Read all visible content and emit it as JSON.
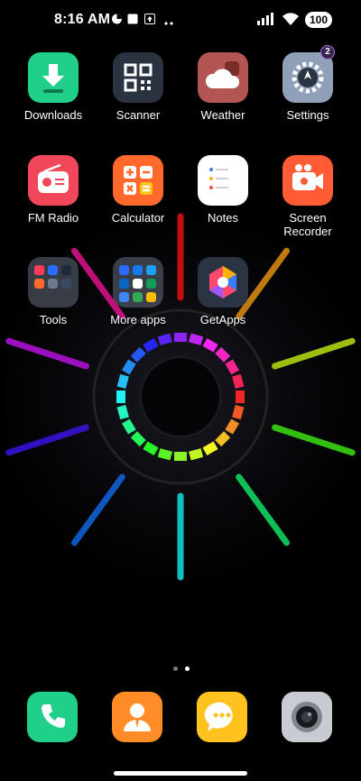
{
  "status_bar": {
    "time": "8:16 AM",
    "icons": [
      "data-saver-icon",
      "stop-icon",
      "upload-icon",
      "more-dots-icon"
    ],
    "signal": "cellular-signal-icon",
    "wifi": "wifi-icon",
    "battery": "100"
  },
  "apps": [
    {
      "label": "Downloads",
      "icon": "download-icon",
      "color": "#1fcf8a"
    },
    {
      "label": "Scanner",
      "icon": "qr-scanner-icon",
      "color": "#2b3340"
    },
    {
      "label": "Weather",
      "icon": "cloud-icon",
      "color": "#b35553"
    },
    {
      "label": "Settings",
      "icon": "gear-icon",
      "color": "#8fa0b8",
      "badge": "2"
    },
    {
      "label": "FM Radio",
      "icon": "radio-icon",
      "color": "#f0485a"
    },
    {
      "label": "Calculator",
      "icon": "calculator-icon",
      "color": "#ff6a2c"
    },
    {
      "label": "Notes",
      "icon": "notes-icon",
      "color": "#ffffff"
    },
    {
      "label": "Screen\nRecorder",
      "label_line1": "Screen",
      "label_line2": "Recorder",
      "icon": "video-camera-icon",
      "color": "#ff5b35"
    },
    {
      "label": "Tools",
      "icon": "folder-icon",
      "color": "#4a5160"
    },
    {
      "label": "More apps",
      "icon": "folder-icon",
      "color": "#4a5160"
    },
    {
      "label": "GetApps",
      "icon": "getapps-icon",
      "color": "#2a3442"
    }
  ],
  "page_indicator": {
    "pages": 2,
    "current": 2
  },
  "dock": [
    {
      "name": "phone",
      "icon": "phone-icon",
      "color": "#1fcf8a"
    },
    {
      "name": "contacts",
      "icon": "contact-icon",
      "color": "#ff8c26"
    },
    {
      "name": "messages",
      "icon": "message-icon",
      "color": "#ffc21e"
    },
    {
      "name": "camera",
      "icon": "camera-icon",
      "color": "#b8bcc4"
    }
  ]
}
